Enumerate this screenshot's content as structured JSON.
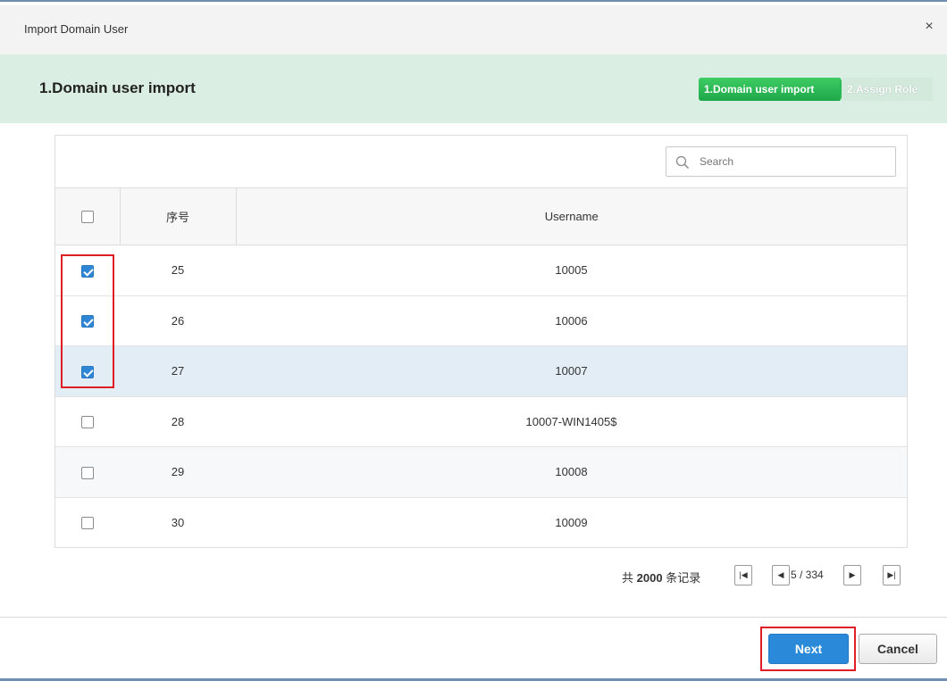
{
  "dialog": {
    "title": "Import Domain User",
    "close_label": "×"
  },
  "stepbar": {
    "heading": "1.Domain user import",
    "steps": [
      {
        "label": "1.Domain user import",
        "active": true
      },
      {
        "label": "2.Assign Role",
        "active": false
      }
    ]
  },
  "search": {
    "placeholder": "Search",
    "icon": "search-icon"
  },
  "table": {
    "columns": [
      "序号",
      "Username"
    ],
    "rows": [
      {
        "index": "25",
        "username": "10005",
        "checked": true
      },
      {
        "index": "26",
        "username": "10006",
        "checked": true
      },
      {
        "index": "27",
        "username": "10007",
        "checked": true
      },
      {
        "index": "28",
        "username": "10007-WIN1405$",
        "checked": false
      },
      {
        "index": "29",
        "username": "10008",
        "checked": false
      },
      {
        "index": "30",
        "username": "10009",
        "checked": false
      }
    ]
  },
  "pager": {
    "total_prefix": "共",
    "total_count": "2000",
    "total_suffix": "条记录",
    "page_info": "5 / 334",
    "first_icon": "first-page-icon",
    "prev_icon": "prev-page-icon",
    "next_icon": "next-page-icon",
    "last_icon": "last-page-icon"
  },
  "footer": {
    "next_label": "Next",
    "cancel_label": "Cancel"
  },
  "colors": {
    "accent": "#2a8ad9",
    "step_active": "#2bb955",
    "stepbar_bg": "#dbeee3",
    "highlight_row": "#e3edf6",
    "annotation_red": "#e01c24"
  }
}
